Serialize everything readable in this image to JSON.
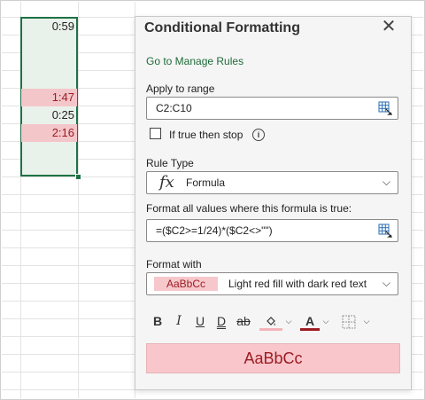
{
  "sheet": {
    "cells": [
      {
        "row": 1,
        "text": "0:59",
        "style": "plain"
      },
      {
        "row": 5,
        "text": "1:47",
        "style": "red"
      },
      {
        "row": 6,
        "text": "0:25",
        "style": "plain"
      },
      {
        "row": 7,
        "text": "2:16",
        "style": "red"
      }
    ]
  },
  "panel": {
    "title": "Conditional Formatting",
    "close_icon": "close-icon",
    "manage_rules_link": "Go to Manage Rules",
    "apply_to_range_label": "Apply to range",
    "apply_to_range_value": "C2:C10",
    "if_true_stop_label": "If true then stop",
    "rule_type_label": "Rule Type",
    "rule_type_icon": "fx",
    "rule_type_value": "Formula",
    "formula_label": "Format all values where this formula is true:",
    "formula_value": "=($C2>=1/24)*($C2<>\"\")",
    "format_with_label": "Format with",
    "format_sample": "AaBbCc",
    "format_with_value": "Light red fill with dark red text",
    "toolbar": {
      "bold": "B",
      "italic": "I",
      "underline": "U",
      "double_underline": "D",
      "strikethrough": "ab"
    },
    "preview_text": "AaBbCc"
  },
  "colors": {
    "accent_green": "#1e7145",
    "light_red_fill": "#f7c8cb",
    "dark_red_text": "#9c1c23"
  }
}
